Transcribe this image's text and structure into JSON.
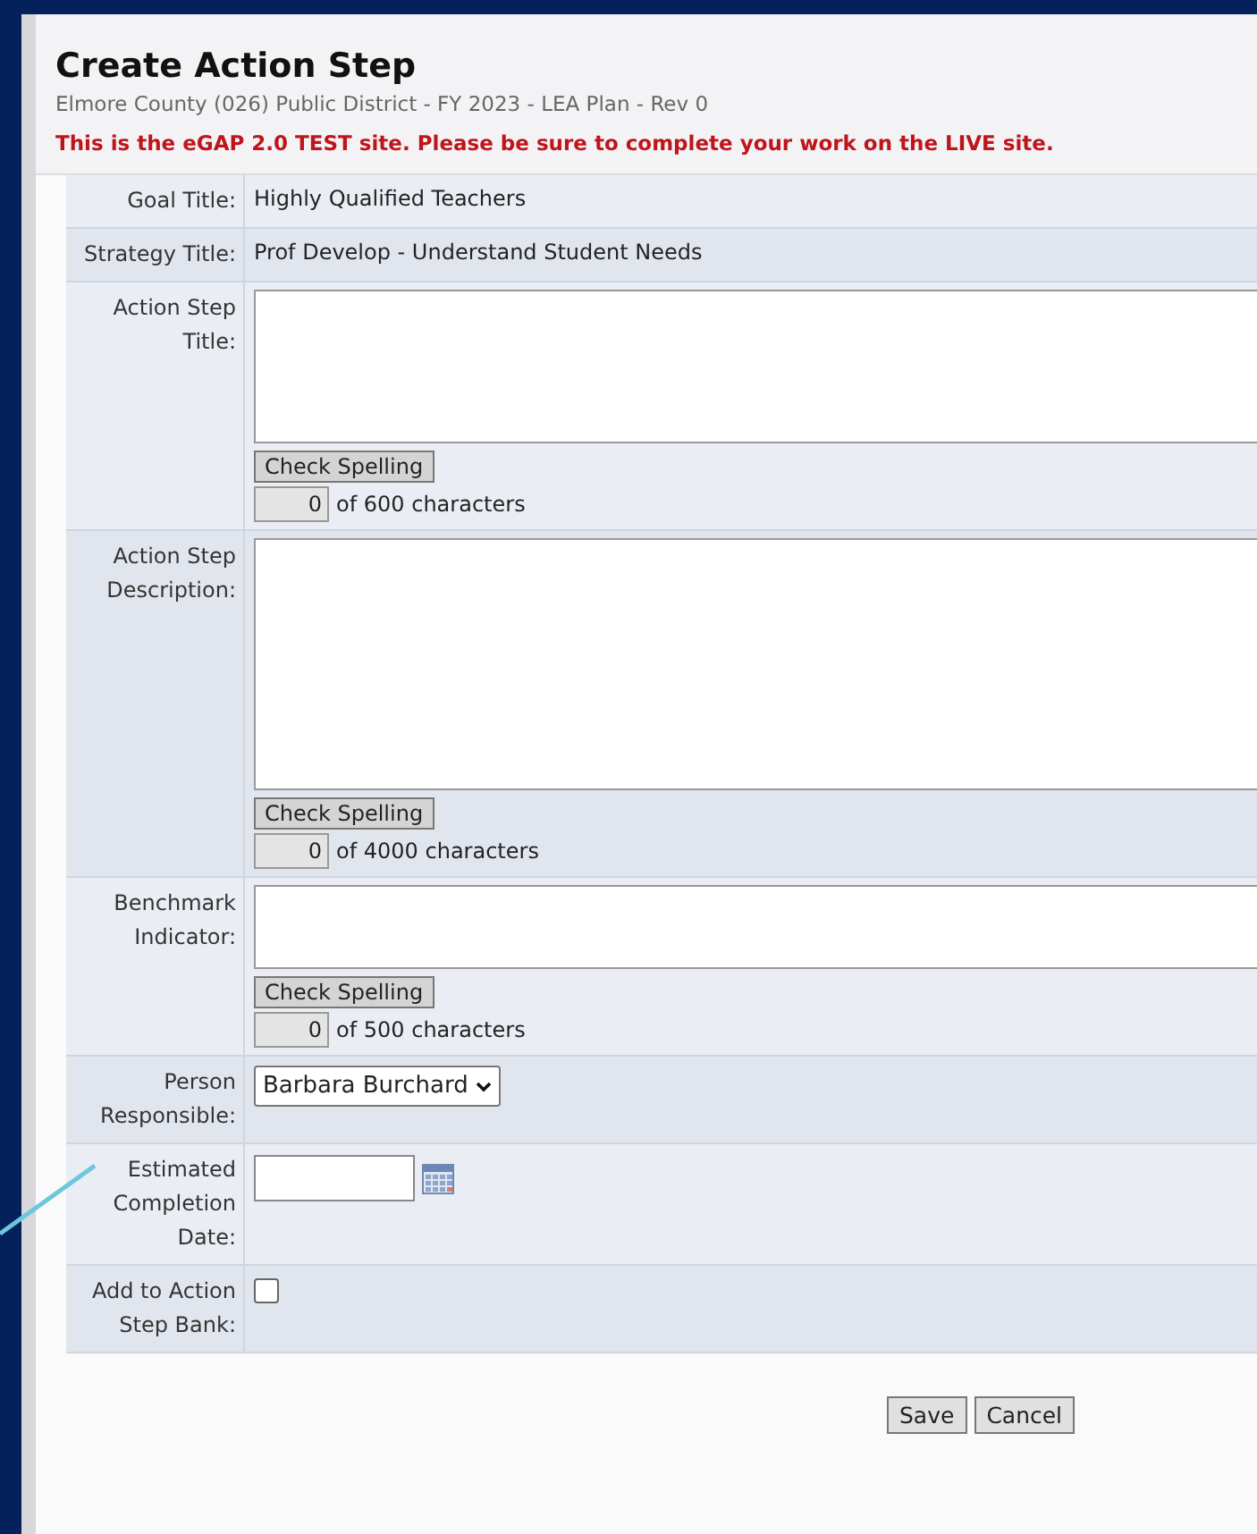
{
  "header": {
    "title": "Create Action Step",
    "subtitle": "Elmore County (026) Public District - FY 2023 - LEA Plan - Rev 0",
    "warning": "This is the eGAP 2.0 TEST site. Please be sure to complete your work on the LIVE site."
  },
  "rows": [
    {
      "kind": "text",
      "label": "Goal Title:",
      "value": "Highly Qualified Teachers"
    },
    {
      "kind": "text",
      "label": "Strategy Title:",
      "value": "Prof Develop - Understand Student Needs"
    },
    {
      "kind": "textarea",
      "label": "Action Step Title:",
      "button": "Check Spelling",
      "count": "0",
      "suffix": "of 600 characters"
    },
    {
      "kind": "textarea",
      "label": "Action Step Description:",
      "button": "Check Spelling",
      "count": "0",
      "suffix": "of 4000 characters"
    },
    {
      "kind": "textarea",
      "label": "Benchmark Indicator:",
      "button": "Check Spelling",
      "count": "0",
      "suffix": "of 500 characters"
    },
    {
      "kind": "select",
      "label": "Person Responsible:",
      "value": "Barbara Burchard"
    },
    {
      "kind": "date",
      "label": "Estimated Completion Date:"
    },
    {
      "kind": "checkbox",
      "label": "Add to Action Step Bank:",
      "checked": false
    }
  ],
  "buttons": [
    "Save",
    "Cancel"
  ]
}
